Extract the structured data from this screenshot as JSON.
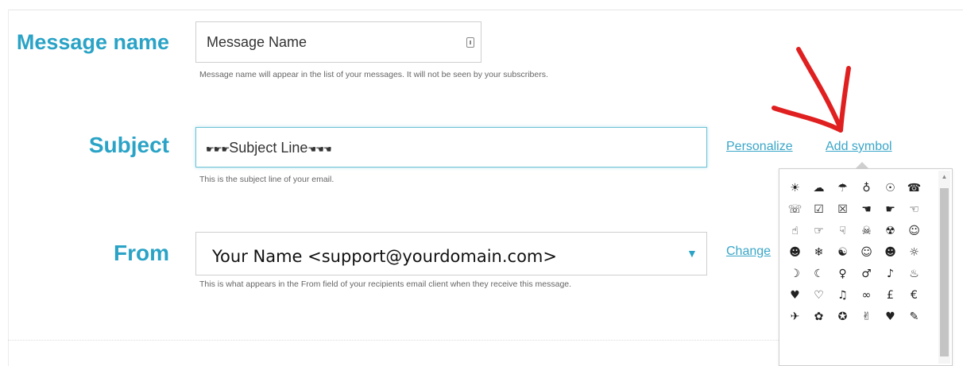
{
  "message_name": {
    "label": "Message name",
    "value": "Message Name",
    "hint": "Message name will appear in the list of your messages. It will not be seen by your subscribers."
  },
  "subject": {
    "label": "Subject",
    "value": "Subject Line",
    "hint": "This is the subject line of your email.",
    "personalize_link": "Personalize",
    "add_symbol_link": "Add symbol"
  },
  "from": {
    "label": "From",
    "value": "Your Name <support@yourdomain.com>",
    "hint": "This is what appears in the From field of your recipients email client when they receive this message.",
    "change_link": "Change"
  },
  "symbols": [
    "☀",
    "☁",
    "☂",
    "♁",
    "☉",
    "☎",
    "☏",
    "☑",
    "☒",
    "☚",
    "☛",
    "☜",
    "☝",
    "☞",
    "☟",
    "☠",
    "☢",
    "☺",
    "☻",
    "❄",
    "☯",
    "☺",
    "☻",
    "☼",
    "☽",
    "☾",
    "♀",
    "♂",
    "♪",
    "♨",
    "♥",
    "♡",
    "♫",
    "∞",
    "£",
    "€",
    "✈",
    "✿",
    "✪",
    "✌",
    "♥",
    "✎"
  ],
  "colors": {
    "accent": "#2aa3c6",
    "annotation_arrow": "#e02020"
  }
}
